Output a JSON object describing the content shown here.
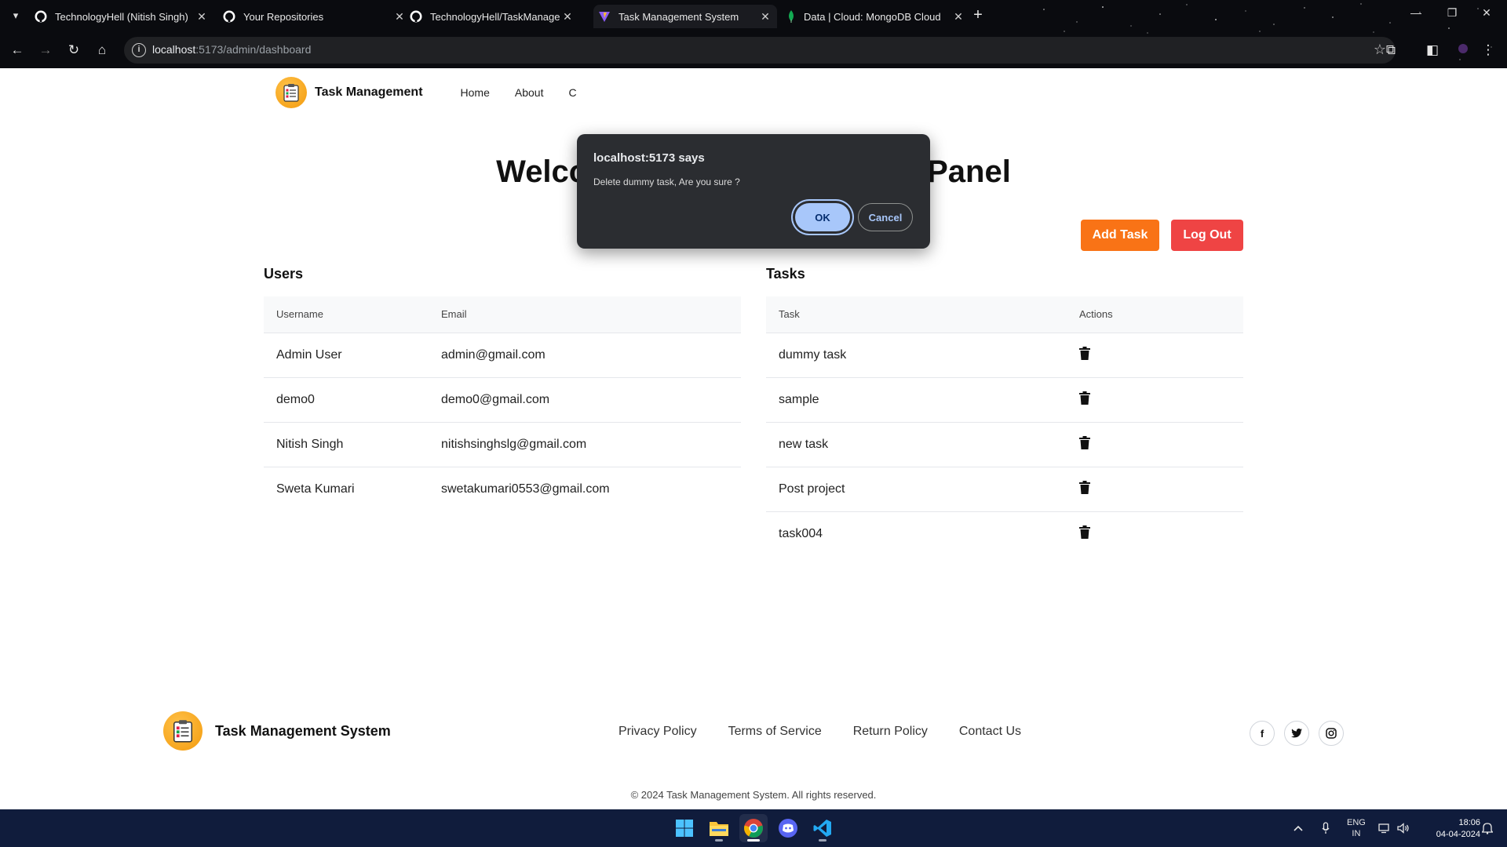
{
  "browser": {
    "tabs": [
      {
        "title": "TechnologyHell (Nitish Singh)",
        "icon": "github-icon"
      },
      {
        "title": "Your Repositories",
        "icon": "github-icon"
      },
      {
        "title": "TechnologyHell/TaskManageme",
        "icon": "github-icon"
      },
      {
        "title": "Task Management System",
        "icon": "vite-icon"
      },
      {
        "title": "Data | Cloud: MongoDB Cloud",
        "icon": "mongodb-leaf-icon"
      }
    ],
    "url_host": "localhost",
    "url_path": ":5173/admin/dashboard"
  },
  "nav": {
    "brand": "Task Management",
    "links": [
      "Home",
      "About",
      "C"
    ]
  },
  "hero": {
    "title": "Welcome to the Admin Dash Panel"
  },
  "actions": {
    "add_task": "Add Task",
    "log_out": "Log Out"
  },
  "users": {
    "title": "Users",
    "headers": [
      "Username",
      "Email"
    ],
    "rows": [
      [
        "Admin User",
        "admin@gmail.com"
      ],
      [
        "demo0",
        "demo0@gmail.com"
      ],
      [
        "Nitish Singh",
        "nitishsinghslg@gmail.com"
      ],
      [
        "Sweta Kumari",
        "swetakumari0553@gmail.com"
      ]
    ]
  },
  "tasks": {
    "title": "Tasks",
    "headers": [
      "Task",
      "Actions"
    ],
    "rows": [
      "dummy task",
      "sample",
      "new task",
      "Post project",
      "task004"
    ]
  },
  "dialog": {
    "title": "localhost:5173 says",
    "message": "Delete dummy task, Are you sure ?",
    "ok": "OK",
    "cancel": "Cancel"
  },
  "footer": {
    "brand": "Task Management System",
    "links": [
      "Privacy Policy",
      "Terms of Service",
      "Return Policy",
      "Contact Us"
    ],
    "social": [
      "facebook-icon",
      "twitter-icon",
      "instagram-icon"
    ],
    "copyright": "© 2024 Task Management System. All rights reserved."
  },
  "taskbar": {
    "apps": [
      "windows-start-icon",
      "file-explorer-icon",
      "chrome-icon",
      "discord-icon",
      "vscode-icon"
    ],
    "language": [
      "ENG",
      "IN"
    ],
    "time": "18:06",
    "date": "04-04-2024"
  },
  "colors": {
    "add_button": "#f97316",
    "logout_button": "#ef4444",
    "dialog_bg": "#2b2d31",
    "dialog_ok": "#a8c7fa",
    "taskbar": "#101c3c"
  }
}
